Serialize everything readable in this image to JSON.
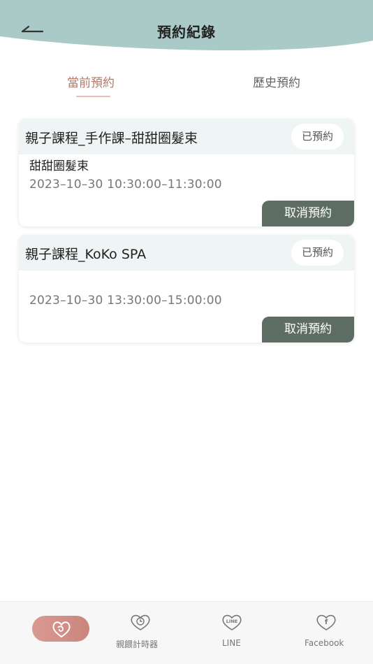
{
  "header": {
    "title": "預約紀錄",
    "back_icon": "back-arrow-icon",
    "color": "#a9cac6"
  },
  "tabs": [
    {
      "label": "當前預約",
      "active": true
    },
    {
      "label": "歷史預約",
      "active": false
    }
  ],
  "bookings": [
    {
      "title": "親子課程_手作課–甜甜圈髮束",
      "status": "已預約",
      "subtitle": "甜甜圈髮束",
      "time": "2023–10–30 10:30:00–11:30:00",
      "action": "取消預約"
    },
    {
      "title": "親子課程_KoKo SPA",
      "status": "已預約",
      "subtitle": "",
      "time": "2023–10–30 13:30:00–15:00:00",
      "action": "取消預約"
    }
  ],
  "bottom_nav": [
    {
      "label": "",
      "icon": "heart-logo-icon",
      "active": true
    },
    {
      "label": "親餵計時器",
      "icon": "timer-heart-icon"
    },
    {
      "label": "LINE",
      "icon": "line-heart-icon"
    },
    {
      "label": "Facebook",
      "icon": "facebook-heart-icon"
    }
  ],
  "colors": {
    "accent": "#b6786c",
    "button": "#5e6d63",
    "card_header": "#eef5f4"
  }
}
